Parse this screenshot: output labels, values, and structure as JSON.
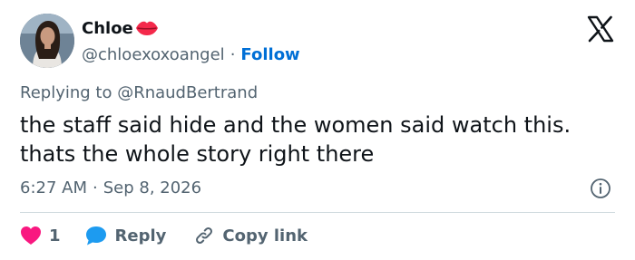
{
  "user": {
    "display_name": "Chloe",
    "handle": "@chloexoxoangel",
    "separator": "·",
    "follow_label": "Follow"
  },
  "reply": {
    "text": "Replying to @RnaudBertrand"
  },
  "tweet": {
    "text": "the staff said hide and the women said watch this.\nthats the whole story right there",
    "time": "6:27 AM",
    "separator": "·",
    "date": "Sep 8, 2026"
  },
  "actions": {
    "like_count": "1",
    "reply_label": "Reply",
    "copy_link_label": "Copy link"
  },
  "icons": {
    "lips": "lips-emoji-icon",
    "x_logo": "x-logo-icon",
    "info": "info-icon",
    "heart": "heart-icon",
    "reply": "reply-bubble-icon",
    "link": "link-icon"
  },
  "colors": {
    "heart": "#f91880",
    "reply_bubble": "#1d9bf0",
    "follow": "#006fd6",
    "text": "#0f1419",
    "muted": "#536471",
    "divider": "#cfd9de"
  }
}
